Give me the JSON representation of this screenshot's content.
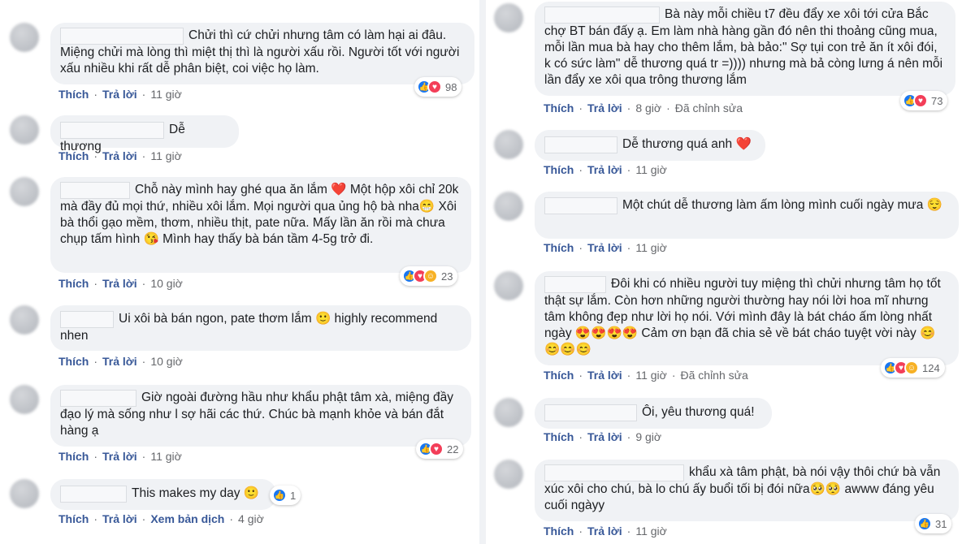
{
  "labels": {
    "like": "Thích",
    "reply": "Trả lời",
    "translate": "Xem bản dịch",
    "edited": "Đã chỉnh sửa",
    "sep": "·"
  },
  "left": [
    {
      "text": "Chửi thì cứ chửi nhưng tâm có làm hại ai đâu. Miệng chửi mà lòng thì miệt thị thì là người xấu rồi. Người tốt với người xấu nhiều khi rất dễ phân biệt, coi việc họ làm.",
      "time": "11 giờ",
      "reactions": [
        "like",
        "love"
      ],
      "count": "98"
    },
    {
      "text": "Dễ thương",
      "time": "11 giờ",
      "reactions": [],
      "count": ""
    },
    {
      "text": "Chỗ này mình hay ghé qua ăn lắm ❤️ Một hộp xôi chỉ 20k mà đầy đủ mọi thứ, nhiều xôi lắm. Mọi người qua ủng hộ bà nha😁 Xôi bà thổi gạo mềm, thơm, nhiều thịt, pate nữa. Mấy lần ăn rồi mà chưa chụp tấm hình 😘 Mình hay thấy bà bán tầm 4-5g trở đi.",
      "time": "10 giờ",
      "reactions": [
        "like",
        "love",
        "care"
      ],
      "count": "23"
    },
    {
      "text": "Ui xôi bà bán ngon, pate thơm lắm 🙂 highly recommend nhen",
      "time": "10 giờ",
      "reactions": [],
      "count": ""
    },
    {
      "text": "Giờ ngoài đường hầu như khẩu phật tâm xà, miệng đầy đạo lý mà sống như l sợ hãi các thứ. Chúc bà mạnh khỏe và bán đắt hàng ạ",
      "time": "11 giờ",
      "reactions": [
        "like",
        "love"
      ],
      "count": "22"
    },
    {
      "text": "This makes my day 🙂",
      "time": "4 giờ",
      "reactions": [
        "like"
      ],
      "count": "1"
    }
  ],
  "right": [
    {
      "text": "Bà này mỗi chiều t7 đều đẩy xe xôi tới cửa Bắc chợ BT bán đấy ạ. Em làm nhà hàng gần đó nên thi thoảng cũng mua, mỗi lần mua bà hay cho thêm lắm, bà bảo:\" Sợ tụi con trẻ ăn ít xôi đói, k có sức làm\" dễ thương quá tr =)))) nhưng mà bả còng lưng á nên mỗi lần đẩy xe xôi qua trông thương lắm",
      "time": "8 giờ",
      "reactions": [
        "like",
        "love"
      ],
      "count": "73"
    },
    {
      "text": "Dễ thương quá anh ❤️",
      "time": "11 giờ",
      "reactions": [],
      "count": ""
    },
    {
      "text": "Một chút dễ thương làm ấm lòng mình cuối ngày mưa 😌",
      "time": "11 giờ",
      "reactions": [],
      "count": ""
    },
    {
      "text": "Đôi khi có nhiều người tuy miệng thì chửi nhưng tâm họ tốt thật sự lắm. Còn hơn những người thường hay nói lời hoa mĩ nhưng tâm không đẹp như lời họ nói. Với mình đây là bát cháo ấm lòng nhất ngày 😍😍😍😍 Cảm ơn bạn đã chia sẻ về bát cháo tuyệt vời này 😊😊😊😊",
      "time": "11 giờ",
      "reactions": [
        "like",
        "love",
        "care"
      ],
      "count": "124"
    },
    {
      "text": "Ôi, yêu thương quá!",
      "time": "9 giờ",
      "reactions": [],
      "count": ""
    },
    {
      "text": "khẩu xà tâm phật, bà nói vậy thôi chứ bà vẫn xúc xôi cho chú, bà lo chú ấy buổi tối bị đói nữa🥺🥺 awww đáng yêu cuối ngàyy",
      "time": "11 giờ",
      "reactions": [
        "like"
      ],
      "count": "31"
    }
  ]
}
